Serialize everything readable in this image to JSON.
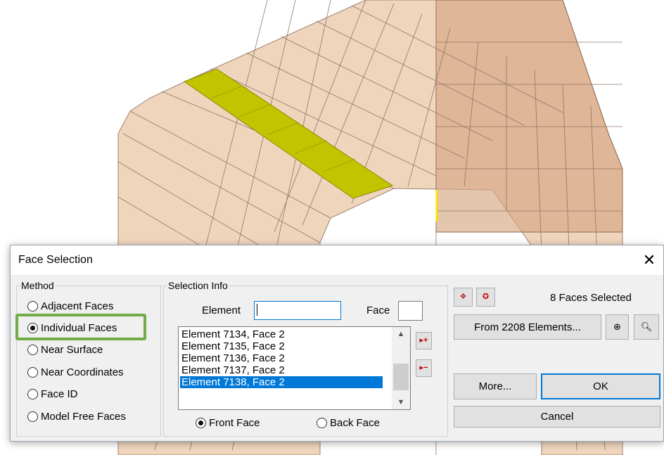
{
  "dialog": {
    "title": "Face Selection",
    "close_icon": "close-icon"
  },
  "method": {
    "legend": "Method",
    "options": [
      "Adjacent Faces",
      "Individual Faces",
      "Near Surface",
      "Near Coordinates",
      "Face ID",
      "Model Free Faces"
    ],
    "selected": "Individual Faces"
  },
  "selection_info": {
    "legend": "Selection Info",
    "element_label": "Element",
    "element_value": "",
    "face_label": "Face",
    "face_value": "",
    "list": [
      "Element 7134, Face 2",
      "Element 7135, Face 2",
      "Element 7136, Face 2",
      "Element 7137, Face 2",
      "Element 7138, Face 2"
    ],
    "selected_item": "Element 7138, Face 2",
    "add_icon": "add-to-list-icon",
    "remove_icon": "remove-from-list-icon",
    "front_face": "Front Face",
    "back_face": "Back Face",
    "side_selected": "Front Face"
  },
  "right_panel": {
    "status": "8 Faces Selected",
    "from_button": "From 2208 Elements...",
    "more_button": "More...",
    "ok_button": "OK",
    "cancel_button": "Cancel",
    "icons": [
      "select-all-icon",
      "clear-selection-icon",
      "globe-icon",
      "zoom-icon"
    ]
  },
  "colors": {
    "mesh_fill": "#f0d5bd",
    "mesh_dark": "#d5a682",
    "selected_faces": "#c3c400",
    "highlight_box": "#70ad47",
    "accent": "#0078d7"
  }
}
